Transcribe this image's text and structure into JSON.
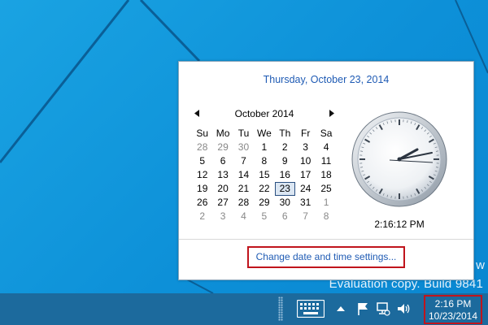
{
  "desktop": {
    "watermark_partial": "w",
    "watermark": "Evaluation copy. Build 9841"
  },
  "popup": {
    "header_date": "Thursday, October 23, 2014",
    "calendar": {
      "month_title": "October 2014",
      "weekdays": [
        "Su",
        "Mo",
        "Tu",
        "We",
        "Th",
        "Fr",
        "Sa"
      ],
      "weeks": [
        [
          "28",
          "29",
          "30",
          "1",
          "2",
          "3",
          "4"
        ],
        [
          "5",
          "6",
          "7",
          "8",
          "9",
          "10",
          "11"
        ],
        [
          "12",
          "13",
          "14",
          "15",
          "16",
          "17",
          "18"
        ],
        [
          "19",
          "20",
          "21",
          "22",
          "23",
          "24",
          "25"
        ],
        [
          "26",
          "27",
          "28",
          "29",
          "30",
          "31",
          "1"
        ],
        [
          "2",
          "3",
          "4",
          "5",
          "6",
          "7",
          "8"
        ]
      ],
      "selected_day": "23"
    },
    "clock_time": "2:16:12 PM",
    "settings_link": "Change date and time settings..."
  },
  "taskbar": {
    "icons": [
      "touch-keyboard-icon",
      "show-hidden-icons-chevron-icon",
      "action-center-flag-icon",
      "network-icon",
      "volume-icon"
    ],
    "time": "2:16 PM",
    "date": "10/23/2014"
  },
  "colors": {
    "accent_link": "#1f5bb4",
    "highlight_border": "#c0141c",
    "taskbar": "#1c6a9d",
    "desktop": "#0d90d8"
  }
}
